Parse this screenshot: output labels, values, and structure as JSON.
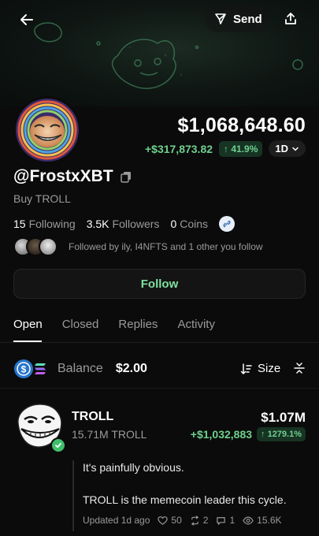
{
  "header": {
    "send_label": "Send",
    "icons": [
      "arrow-left-icon",
      "send-icon",
      "share-icon"
    ]
  },
  "profile": {
    "handle": "@FrostxXBT",
    "bio": "Buy TROLL",
    "portfolio_value": "$1,068,648.60",
    "change_amount": "+$317,873.82",
    "change_pct": "↑ 41.9%",
    "range": "1D",
    "following_count": "15",
    "following_label": "Following",
    "followers_count": "3.5K",
    "followers_label": "Followers",
    "coins_count": "0",
    "coins_label": "Coins",
    "followed_by": "Followed by ily, I4NFTS and 1 other you follow",
    "follow_label": "Follow"
  },
  "tabs": [
    {
      "label": "Open",
      "active": true
    },
    {
      "label": "Closed",
      "active": false
    },
    {
      "label": "Replies",
      "active": false
    },
    {
      "label": "Activity",
      "active": false
    }
  ],
  "balance": {
    "label": "Balance",
    "value": "$2.00",
    "sort_label": "Size"
  },
  "holding": {
    "name": "TROLL",
    "amount": "15.71M TROLL",
    "value": "$1.07M",
    "change": "+$1,032,883",
    "change_pct": "↑ 1279.1%",
    "post_line1": "It's painfully obvious.",
    "post_line2": "TROLL is the memecoin leader this cycle.",
    "updated": "Updated 1d ago",
    "likes": "50",
    "reposts": "2",
    "comments": "1",
    "views": "15.6K"
  },
  "colors": {
    "background": "#0b0b0b",
    "positive": "#6fd08f",
    "positive_bg": "#173323",
    "muted": "#9a9a9a"
  }
}
